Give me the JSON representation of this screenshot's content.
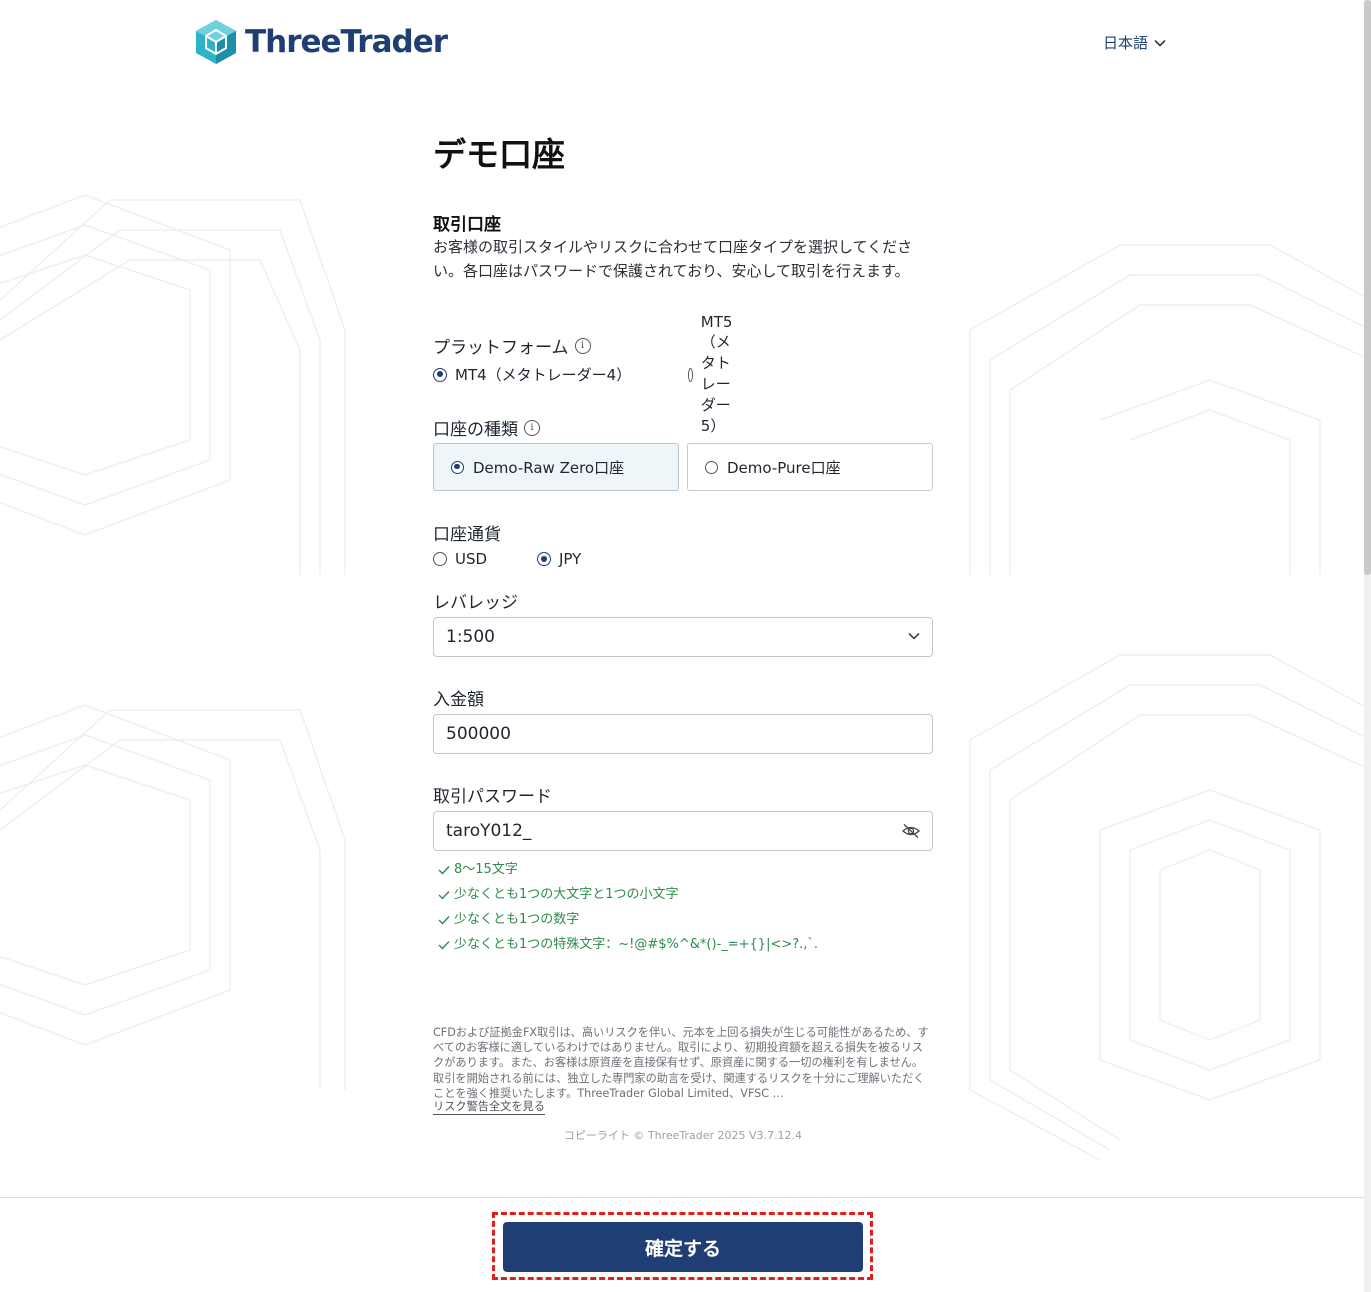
{
  "header": {
    "brand": "ThreeTrader",
    "language": "日本語"
  },
  "page": {
    "title": "デモ口座",
    "section_title": "取引口座",
    "section_desc": "お客様の取引スタイルやリスクに合わせて口座タイプを選択してください。各口座はパスワードで保護されており、安心して取引を行えます。"
  },
  "platform": {
    "label": "プラットフォーム",
    "options": [
      {
        "label": "MT4（メタトレーダー4）",
        "selected": true
      },
      {
        "label": "MT5（メタトレーダー5）",
        "selected": false
      }
    ]
  },
  "account_type": {
    "label": "口座の種類",
    "options": [
      {
        "label": "Demo-Raw Zero口座",
        "selected": true
      },
      {
        "label": "Demo-Pure口座",
        "selected": false
      }
    ]
  },
  "currency": {
    "label": "口座通貨",
    "options": [
      {
        "label": "USD",
        "selected": false
      },
      {
        "label": "JPY",
        "selected": true
      }
    ]
  },
  "leverage": {
    "label": "レバレッジ",
    "value": "1:500"
  },
  "deposit": {
    "label": "入金額",
    "value": "500000"
  },
  "password": {
    "label": "取引パスワード",
    "value": "taroY012_",
    "rules": [
      "8～15文字",
      "少なくとも1つの大文字と1つの小文字",
      "少なくとも1つの数字",
      "少なくとも1つの特殊文字：~!@#$%^&*()-_=+{}|<>?.,`."
    ]
  },
  "disclaimer": {
    "text": "CFDおよび証拠金FX取引は、高いリスクを伴い、元本を上回る損失が生じる可能性があるため、すべてのお客様に適しているわけではありません。取引により、初期投資額を超える損失を被るリスクがあります。また、お客様は原資産を直接保有せず、原資産に関する一切の権利を有しません。取引を開始される前には、独立した専門家の助言を受け、関連するリスクを十分にご理解いただくことを強く推奨いたします。ThreeTrader Global Limited、VFSC …",
    "link": "リスク警告全文を見る"
  },
  "copyright": "コピーライト © ThreeTrader 2025 V3.7.12.4",
  "footer": {
    "confirm_label": "確定する"
  },
  "colors": {
    "brand": "#1f3e73",
    "success": "#2e8a4d",
    "highlight": "#e01e1e"
  }
}
